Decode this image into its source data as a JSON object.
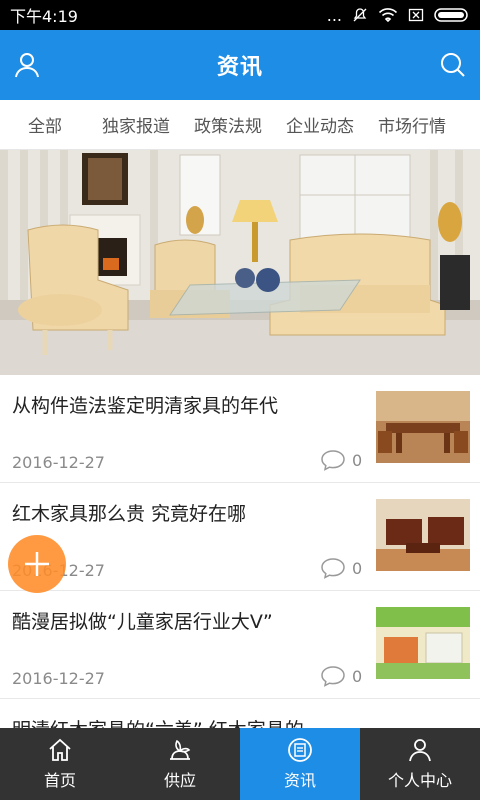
{
  "status_bar": {
    "time": "下午4:19",
    "dots": "...",
    "icons": [
      "mute-icon",
      "wifi-icon",
      "sim-off-icon",
      "battery-icon"
    ]
  },
  "header": {
    "title": "资讯",
    "left_icon": "user-icon",
    "right_icon": "search-icon",
    "color": "#1e8de6"
  },
  "tabs": [
    {
      "label": "全部"
    },
    {
      "label": "独家报道"
    },
    {
      "label": "政策法规"
    },
    {
      "label": "企业动态"
    },
    {
      "label": "市场行情"
    }
  ],
  "news": [
    {
      "title": "从构件造法鉴定明清家具的年代",
      "date": "2016-12-27",
      "comments": "0"
    },
    {
      "title": "红木家具那么贵 究竟好在哪",
      "date": "2016-12-27",
      "comments": "0"
    },
    {
      "title": "酷漫居拟做“儿童家居行业大V”",
      "date": "2016-12-27",
      "comments": "0"
    },
    {
      "title": "明清红木家具的“六美” 红木家具的",
      "date": "",
      "comments": ""
    }
  ],
  "fab": {
    "icon": "plus-icon",
    "color": "#ff8c28"
  },
  "bottom_nav": [
    {
      "label": "首页",
      "icon": "home-icon"
    },
    {
      "label": "供应",
      "icon": "supply-icon"
    },
    {
      "label": "资讯",
      "icon": "news-icon",
      "active": true
    },
    {
      "label": "个人中心",
      "icon": "profile-icon"
    }
  ]
}
